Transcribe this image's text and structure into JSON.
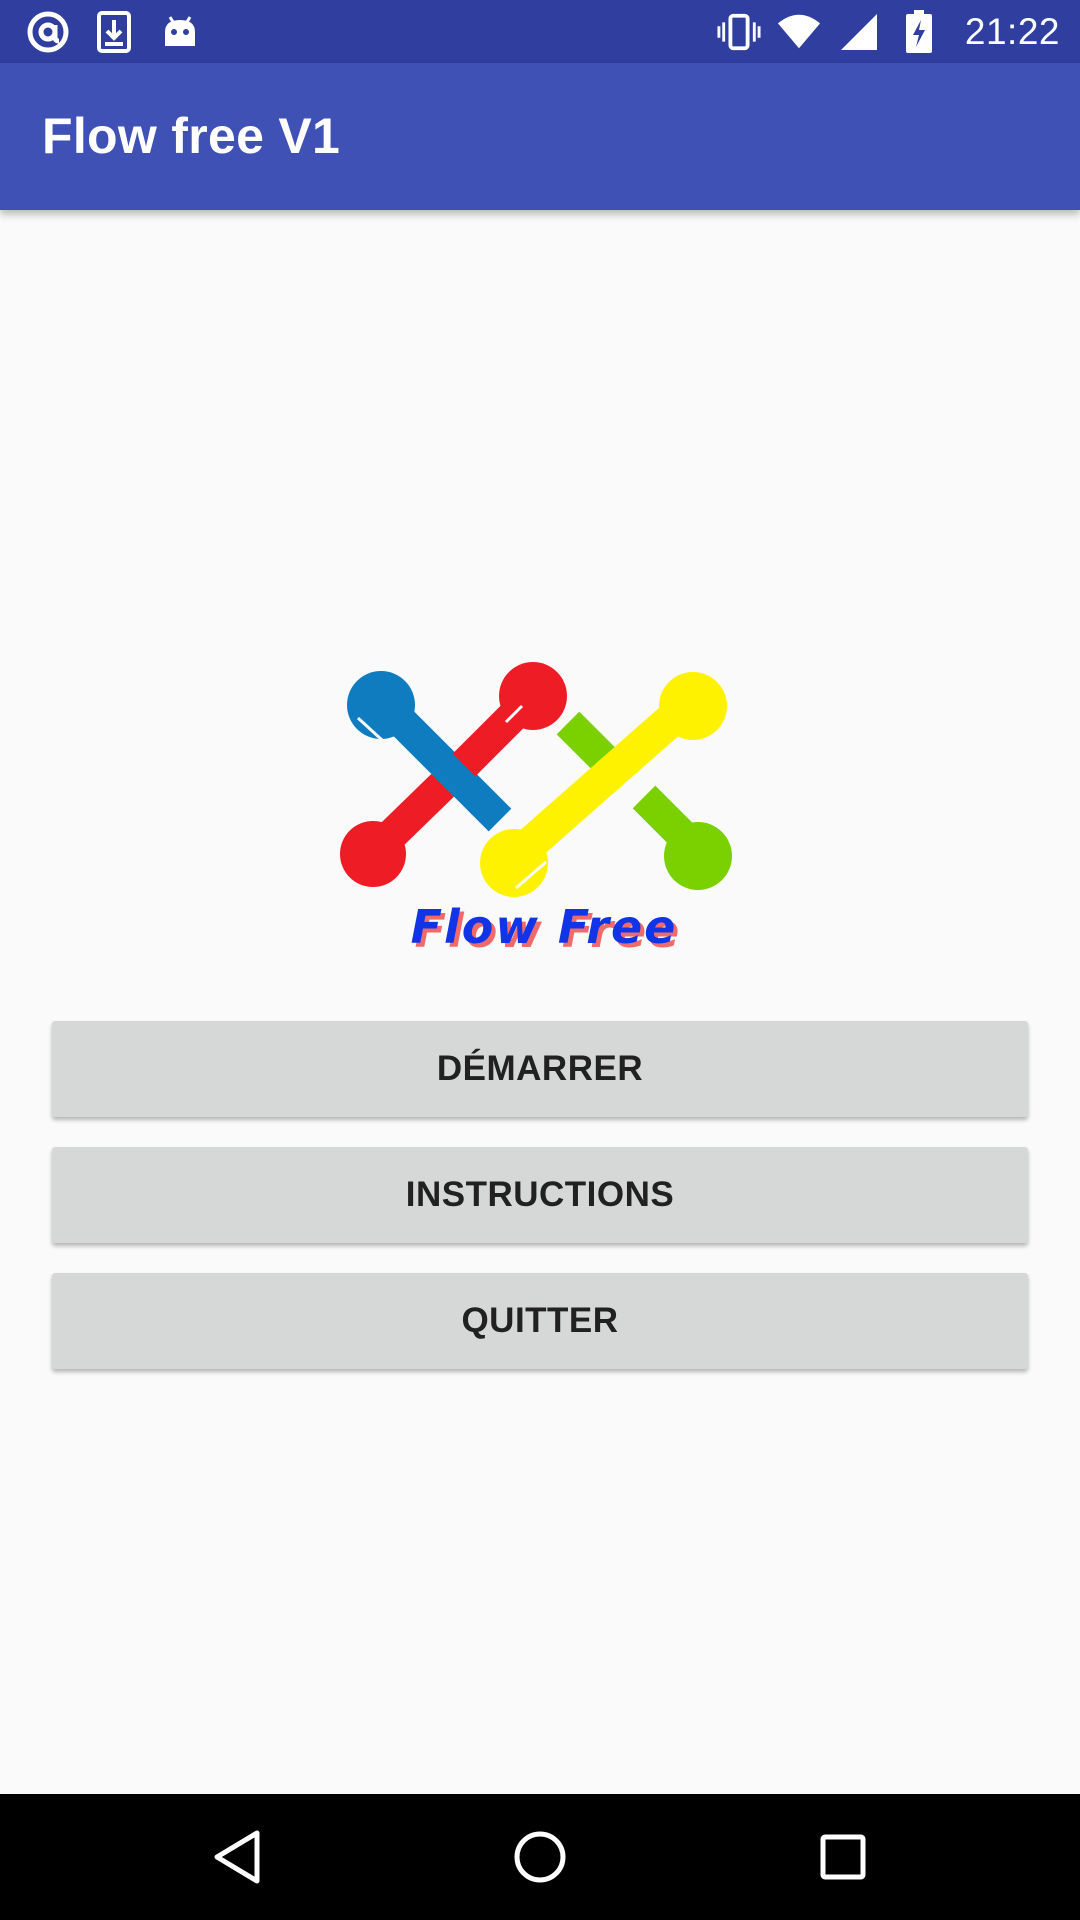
{
  "status_bar": {
    "time": "21:22",
    "left_icons": [
      "at-sign-icon",
      "download-icon",
      "android-icon"
    ],
    "right_icons": [
      "vibrate-icon",
      "wifi-icon",
      "signal-icon",
      "battery-charging-icon"
    ],
    "background_color": "#303f9f"
  },
  "app_bar": {
    "title": "Flow free V1",
    "background_color": "#3f51b5"
  },
  "logo": {
    "wordmark": "Flow Free",
    "colors": {
      "blue": "#0f7cbf",
      "red": "#ee1c25",
      "green": "#7bd100",
      "yellow": "#fff200",
      "wordmark": "#1034e6",
      "wordmark_shadow": "#f06a6a"
    }
  },
  "menu": {
    "buttons": [
      {
        "label": "DÉMARRER"
      },
      {
        "label": "INSTRUCTIONS"
      },
      {
        "label": "QUITTER"
      }
    ],
    "button_color": "#d6d7d7"
  },
  "nav_bar": {
    "icons": [
      "back-icon",
      "home-icon",
      "recents-icon"
    ]
  }
}
